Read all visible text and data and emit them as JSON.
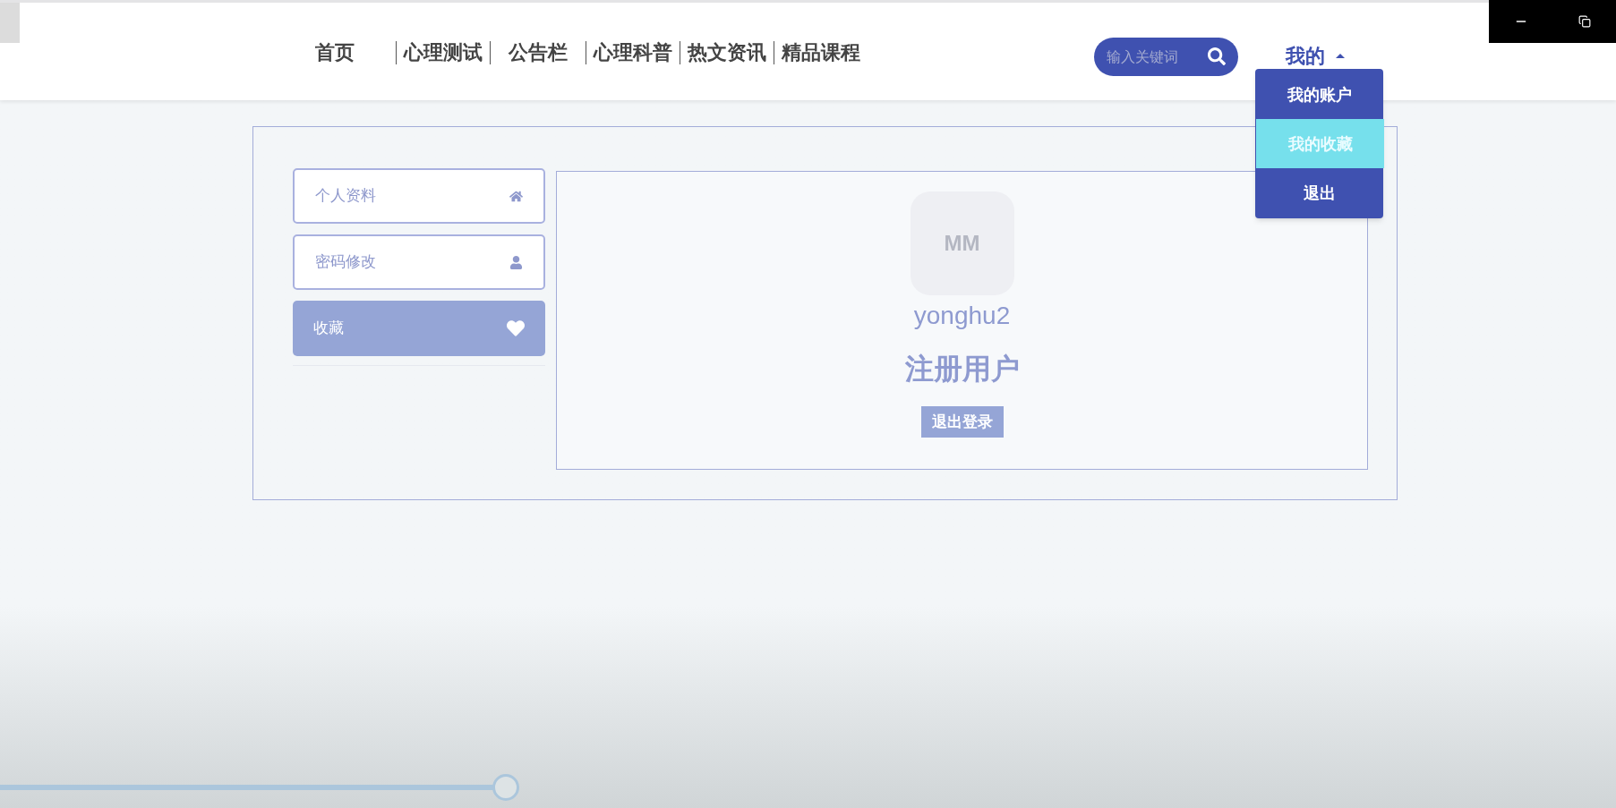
{
  "nav": {
    "items": [
      {
        "label": "首页"
      },
      {
        "label": "心理测试"
      },
      {
        "label": "公告栏"
      },
      {
        "label": "心理科普"
      },
      {
        "label": "热文资讯"
      },
      {
        "label": "精品课程"
      }
    ]
  },
  "search": {
    "placeholder": "输入关键词"
  },
  "user_menu": {
    "label": "我的",
    "expanded": true,
    "items": [
      {
        "label": "我的账户",
        "selected": false
      },
      {
        "label": "我的收藏",
        "selected": true
      },
      {
        "label": "退出",
        "selected": false
      }
    ]
  },
  "sidebar": {
    "items": [
      {
        "label": "个人资料",
        "kind": "home",
        "selected": false
      },
      {
        "label": "密码修改",
        "kind": "user",
        "selected": false
      },
      {
        "label": "收藏",
        "kind": "heart",
        "selected": true
      }
    ]
  },
  "profile": {
    "avatar_text": "MM",
    "username": "yonghu2",
    "role": "注册用户",
    "logout_button": "退出登录"
  },
  "video_player": {
    "progress": {
      "level": 0.313
    }
  }
}
